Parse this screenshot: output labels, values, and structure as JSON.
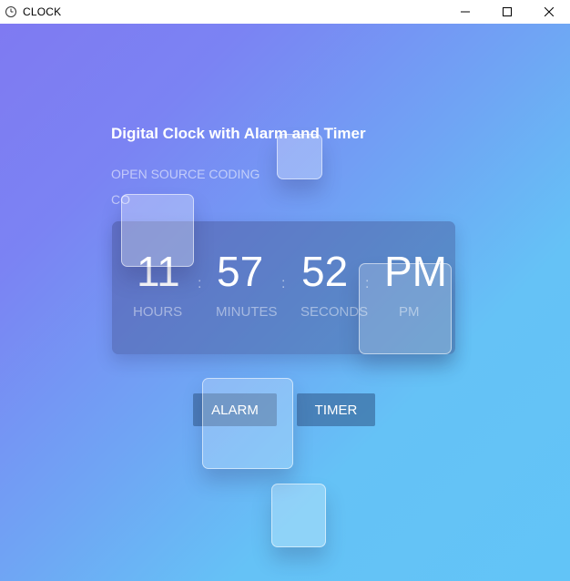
{
  "window": {
    "title": "CLOCK",
    "icon": "clock-app-icon",
    "controls": [
      "minimize-icon",
      "maximize-icon",
      "close-icon"
    ]
  },
  "page": {
    "heading": "Digital Clock with Alarm and Timer",
    "subtitle_line1": "OPEN SOURCE CODING",
    "subtitle_line2": "CO"
  },
  "clock": {
    "hours": "11",
    "minutes": "57",
    "seconds": "52",
    "period": "PM",
    "labels": {
      "hours": "HOURS",
      "minutes": "MINUTES",
      "seconds": "SECONDS",
      "period": "PM"
    },
    "separator": ":"
  },
  "buttons": {
    "alarm": "ALARM",
    "timer": "TIMER"
  },
  "colors": {
    "gradient_start": "#7f7af2",
    "gradient_end": "#62c4f7",
    "button_bg": "#2d5587"
  }
}
